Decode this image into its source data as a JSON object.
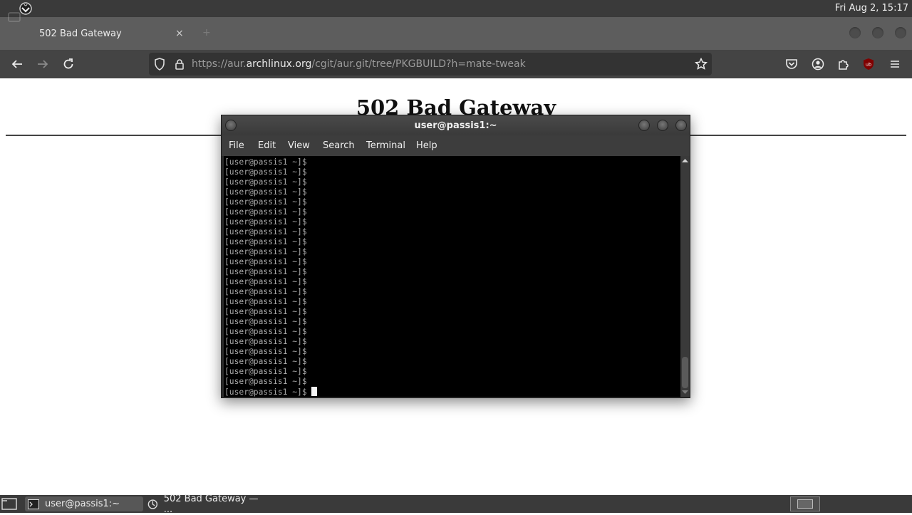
{
  "top_panel": {
    "clock": "Fri Aug  2, 15:17"
  },
  "browser": {
    "tab": {
      "title": "502 Bad Gateway",
      "close_glyph": "×",
      "new_tab_glyph": "+"
    },
    "url": {
      "prefix": "https://aur.",
      "domain": "archlinux.org",
      "path": "/cgit/aur.git/tree/PKGBUILD?h=mate-tweak"
    },
    "icons": [
      "back-icon",
      "forward-icon",
      "reload-icon",
      "shield-icon",
      "lock-icon",
      "bookmark-star-icon",
      "pocket-icon",
      "account-icon",
      "extensions-icon",
      "ublock-icon",
      "hamburger-menu-icon"
    ],
    "ublock_badge": "ub"
  },
  "page": {
    "heading": "502 Bad Gateway"
  },
  "terminal": {
    "title": "user@passis1:~",
    "menu": [
      "File",
      "Edit",
      "View",
      "Search",
      "Terminal",
      "Help"
    ],
    "prompt": "[user@passis1 ~]$ ",
    "prompt_lines": 24
  },
  "taskbar": {
    "items": [
      "user@passis1:~",
      "502 Bad Gateway — ..."
    ]
  },
  "colors": {
    "panel": "#3a3a3a",
    "tabbar": "#5d5d5d",
    "navbar": "#444444",
    "terminal_bg": "#000000",
    "terminal_fg": "#a8a8a8",
    "ublock_red": "#800000"
  }
}
